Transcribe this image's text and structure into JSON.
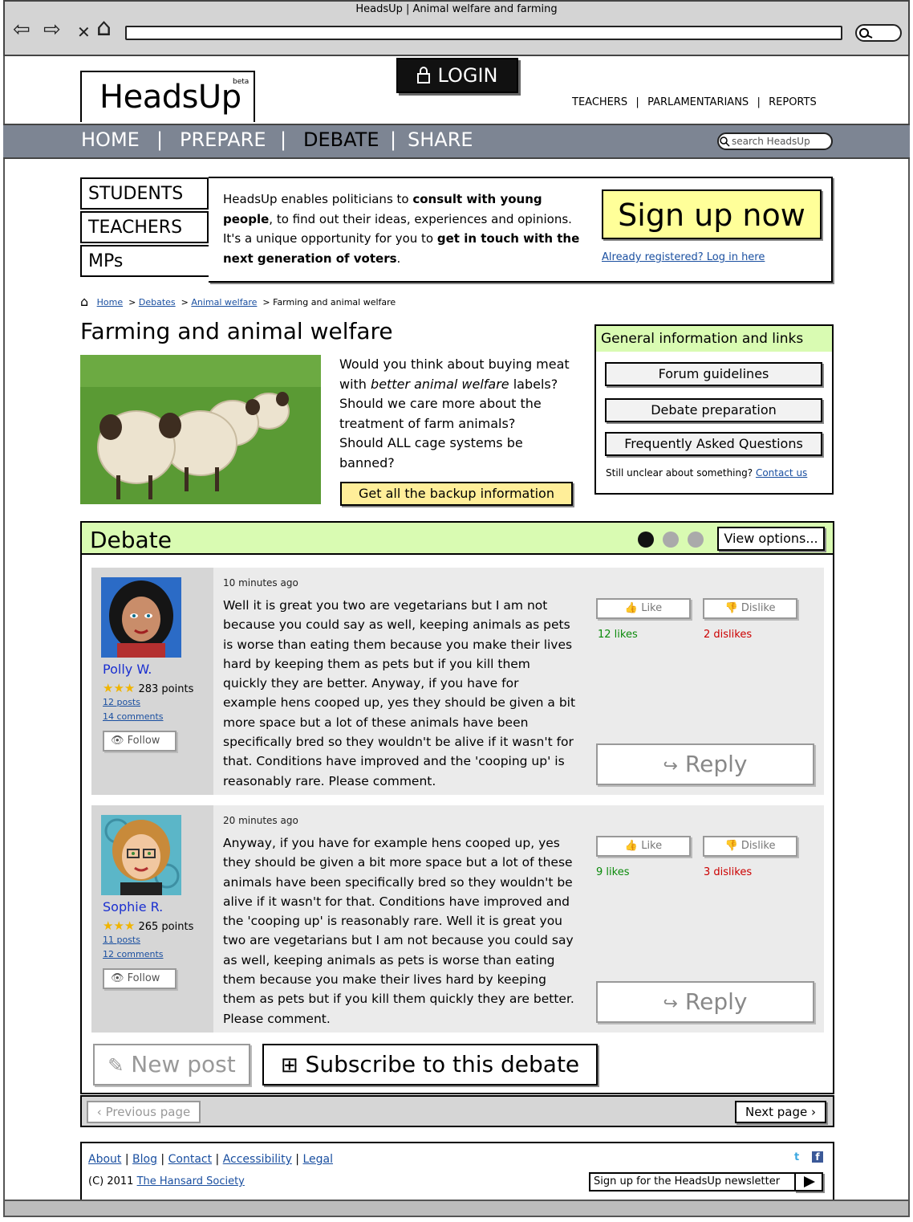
{
  "browser": {
    "title": "HeadsUp | Animal welfare and farming",
    "nav_glyphs": {
      "back": "⇦",
      "forward": "⇨",
      "close": "✕",
      "home": "⌂"
    }
  },
  "header": {
    "logo": "HeadsUp",
    "beta": "beta",
    "login": "LOGIN",
    "top_links": [
      "TEACHERS",
      "PARLAMENTARIANS",
      "REPORTS"
    ],
    "nav": [
      "HOME",
      "PREPARE",
      "DEBATE",
      "SHARE"
    ],
    "search_placeholder": "search HeadsUp"
  },
  "intro": {
    "roles": [
      "STUDENTS",
      "TEACHERS",
      "MPs"
    ],
    "text_brand": "HeadsUp",
    "text_1": " enables politicians to ",
    "text_b1": "consult with young people",
    "text_2": ", to find out their ideas, experiences and opinions. It's a unique opportunity for you to ",
    "text_b2": "get in touch with the next generation of voters",
    "text_3": ".",
    "signup": "Sign up now",
    "already": "Already registered? Log in here"
  },
  "breadcrumb": {
    "items": [
      "Home",
      "Debates",
      "Animal welfare"
    ],
    "current": "Farming and animal welfare"
  },
  "topic": {
    "title": "Farming and animal welfare",
    "q1a": "Would you think about buying meat with ",
    "q1b": "better animal welfare",
    "q1c": " labels?",
    "q2": "Should we care more about the treatment of farm animals?",
    "q3": "Should ALL cage systems be banned?",
    "backup": "Get all the backup information"
  },
  "info": {
    "heading": "General information and links",
    "buttons": [
      "Forum guidelines",
      "Debate preparation",
      "Frequently Asked Questions"
    ],
    "unclear": "Still unclear about something?",
    "contact": "Contact us"
  },
  "debate": {
    "title": "Debate",
    "view_options": "View options...",
    "like_label": "Like",
    "dislike_label": "Dislike",
    "reply_label": "Reply",
    "follow_label": "Follow",
    "posts": [
      {
        "author": "Polly W.",
        "points": "283 points",
        "posts": "12 posts",
        "comments": "14 comments",
        "time": "10 minutes ago",
        "body": "Well it is great you two are vegetarians but I am not because you could say as well, keeping animals as pets is worse than eating them because you make their lives hard by keeping them as pets but if you kill them quickly they are better. Anyway, if you have for example hens cooped up, yes they should be given a bit more space but a lot of these animals have been specifically bred so they wouldn't be alive if it wasn't for that. Conditions have improved and the 'cooping up' is reasonably rare. Please comment.",
        "likes": "12 likes",
        "dislikes": "2 dislikes"
      },
      {
        "author": "Sophie R.",
        "points": "265 points",
        "posts": "11 posts",
        "comments": "12 comments",
        "time": "20 minutes ago",
        "body": "Anyway, if you have for example hens cooped up, yes they should be given a bit more space but a lot of these animals have been specifically bred so they wouldn't be alive if it wasn't for that. Conditions have improved and the 'cooping up' is reasonably rare. Well it is great you two are vegetarians but I am not because you could say as well, keeping animals as pets is worse than eating them because you make their lives hard by keeping them as pets but if you kill them quickly they are better. Please comment.",
        "likes": "9 likes",
        "dislikes": "3 dislikes"
      }
    ],
    "new_post": "New post",
    "subscribe": "Subscribe to this debate",
    "prev_page": "Previous page",
    "next_page": "Next page"
  },
  "footer": {
    "links": [
      "About",
      "Blog",
      "Contact",
      "Accessibility",
      "Legal"
    ],
    "copyright": "(C) 2011",
    "society": "The Hansard Society",
    "newsletter": "Sign up for the HeadsUp newsletter"
  },
  "colors": {
    "navbar": "#7d8593",
    "green_panel": "#d9fbb2",
    "signup_yellow": "#ffff99",
    "link": "#1a4fa0"
  }
}
